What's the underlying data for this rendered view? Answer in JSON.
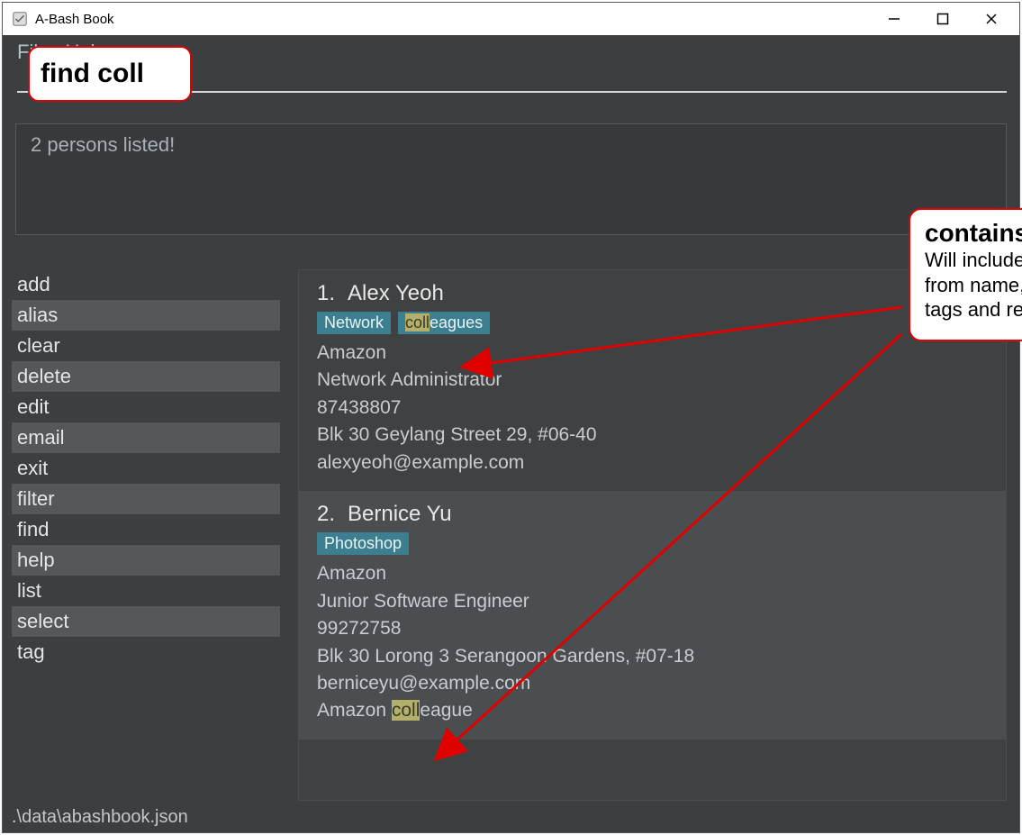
{
  "window": {
    "title": "A-Bash Book",
    "controls": {
      "min": "—",
      "max": "☐",
      "close": "✕"
    }
  },
  "menubar": {
    "file": "File",
    "help": "Help"
  },
  "command_input": {
    "value": "find coll"
  },
  "status": {
    "message": "2 persons listed!"
  },
  "sidebar": {
    "commands": [
      "add",
      "alias",
      "clear",
      "delete",
      "edit",
      "email",
      "exit",
      "filter",
      "find",
      "help",
      "list",
      "select",
      "tag"
    ]
  },
  "results": [
    {
      "index": "1.",
      "name": "Alex Yeoh",
      "tags": [
        {
          "pre": "",
          "hl": "",
          "post": "Network"
        },
        {
          "pre": "",
          "hl": "coll",
          "post": "eagues"
        }
      ],
      "company": "Amazon",
      "role": "Network Administrator",
      "phone": "87438807",
      "address": "Blk 30 Geylang Street 29, #06-40",
      "email": "alexyeoh@example.com",
      "remark_pre": "",
      "remark_hl": "",
      "remark_post": ""
    },
    {
      "index": "2.",
      "name": "Bernice Yu",
      "tags": [
        {
          "pre": "",
          "hl": "",
          "post": "Photoshop"
        }
      ],
      "company": "Amazon",
      "role": "Junior Software Engineer",
      "phone": "99272758",
      "address": "Blk 30 Lorong 3 Serangoon Gardens, #07-18",
      "email": "berniceyu@example.com",
      "remark_pre": "Amazon ",
      "remark_hl": "coll",
      "remark_post": "eague"
    }
  ],
  "footer": {
    "path": ".\\data\\abashbook.json"
  },
  "annotations": {
    "command_callout": "find coll",
    "explain_title": "contains “coll”",
    "explain_line1": "Will include result",
    "explain_line2": "from name, email,",
    "explain_line3": "tags and remarks"
  }
}
